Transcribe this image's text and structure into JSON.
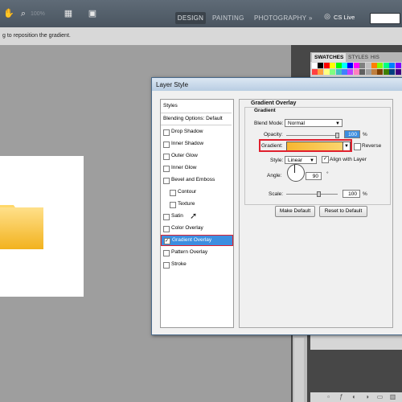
{
  "appbar": {
    "zoom": "100%",
    "workspaces": [
      "DESIGN",
      "PAINTING",
      "PHOTOGRAPHY"
    ],
    "more": "»",
    "cslive": "CS Live"
  },
  "options": {
    "hint": "g to reposition the gradient."
  },
  "panels": {
    "tabs": [
      "SWATCHES",
      "STYLES",
      "HIS"
    ],
    "swatch_colors": [
      "#ffffff",
      "#000000",
      "#ff0000",
      "#ffff00",
      "#00ff00",
      "#00ffff",
      "#0000ff",
      "#ff00ff",
      "#808080",
      "#c0c0c0",
      "#ff8000",
      "#80ff00",
      "#00ff80",
      "#0080ff",
      "#8000ff",
      "#ff4040",
      "#ffa040",
      "#ffff80",
      "#80ff80",
      "#40c0c0",
      "#4080ff",
      "#c040ff",
      "#ff80c0",
      "#606060",
      "#a0a0a0",
      "#c08040",
      "#804000",
      "#408000",
      "#004080",
      "#400080"
    ]
  },
  "dialog": {
    "title": "Layer Style",
    "list": {
      "styles": "Styles",
      "blending": "Blending Options: Default",
      "items": [
        {
          "label": "Drop Shadow",
          "checked": false
        },
        {
          "label": "Inner Shadow",
          "checked": false
        },
        {
          "label": "Outer Glow",
          "checked": false
        },
        {
          "label": "Inner Glow",
          "checked": false
        },
        {
          "label": "Bevel and Emboss",
          "checked": false
        },
        {
          "label": "Contour",
          "checked": false
        },
        {
          "label": "Texture",
          "checked": false
        },
        {
          "label": "Satin",
          "checked": false
        },
        {
          "label": "Color Overlay",
          "checked": false
        },
        {
          "label": "Gradient Overlay",
          "checked": true
        },
        {
          "label": "Pattern Overlay",
          "checked": false
        },
        {
          "label": "Stroke",
          "checked": false
        }
      ]
    },
    "section_title": "Gradient Overlay",
    "group_title": "Gradient",
    "blend_mode_label": "Blend Mode:",
    "blend_mode_value": "Normal",
    "opacity_label": "Opacity:",
    "opacity_value": "100",
    "opacity_unit": "%",
    "gradient_label": "Gradient:",
    "reverse_label": "Reverse",
    "style_label": "Style:",
    "style_value": "Linear",
    "align_label": "Align with Layer",
    "angle_label": "Angle:",
    "angle_value": "90",
    "angle_unit": "°",
    "scale_label": "Scale:",
    "scale_value": "100",
    "scale_unit": "%",
    "make_default": "Make Default",
    "reset_default": "Reset to Default"
  }
}
